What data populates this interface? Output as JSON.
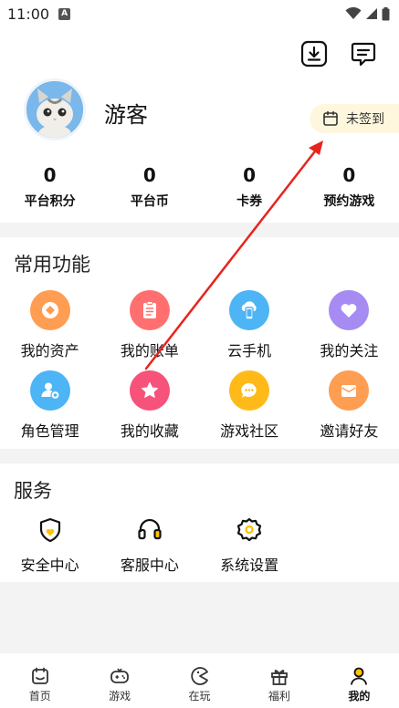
{
  "status_bar": {
    "time": "11:00",
    "sim_label": "A"
  },
  "header": {
    "download_icon": "download-icon",
    "message_icon": "message-icon"
  },
  "profile": {
    "name": "游客",
    "checkin_label": "未签到"
  },
  "stats": [
    {
      "value": "0",
      "label": "平台积分"
    },
    {
      "value": "0",
      "label": "平台币"
    },
    {
      "value": "0",
      "label": "卡券"
    },
    {
      "value": "0",
      "label": "预约游戏"
    }
  ],
  "common": {
    "title": "常用功能",
    "items": [
      {
        "label": "我的资产",
        "icon": "asset-icon",
        "color": "#ff9d52"
      },
      {
        "label": "我的账单",
        "icon": "bill-icon",
        "color": "#ff6f6f"
      },
      {
        "label": "云手机",
        "icon": "cloud-phone-icon",
        "color": "#4db4f5"
      },
      {
        "label": "我的关注",
        "icon": "heart-icon",
        "color": "#a58bf2"
      },
      {
        "label": "角色管理",
        "icon": "role-icon",
        "color": "#4db4f5"
      },
      {
        "label": "我的收藏",
        "icon": "star-icon",
        "color": "#f6527a"
      },
      {
        "label": "游戏社区",
        "icon": "chat-icon",
        "color": "#ffba1a"
      },
      {
        "label": "邀请好友",
        "icon": "mail-icon",
        "color": "#ff9d52"
      }
    ]
  },
  "services": {
    "title": "服务",
    "items": [
      {
        "label": "安全中心",
        "icon": "shield-icon"
      },
      {
        "label": "客服中心",
        "icon": "headset-icon"
      },
      {
        "label": "系统设置",
        "icon": "gear-icon"
      }
    ]
  },
  "tabs": [
    {
      "label": "首页",
      "icon": "home-icon",
      "active": false
    },
    {
      "label": "游戏",
      "icon": "gamepad-icon",
      "active": false
    },
    {
      "label": "在玩",
      "icon": "playing-icon",
      "active": false
    },
    {
      "label": "福利",
      "icon": "gift-icon",
      "active": false
    },
    {
      "label": "我的",
      "icon": "person-icon",
      "active": true
    }
  ],
  "colors": {
    "accent": "#ffc400",
    "annotation": "#e8231e"
  }
}
